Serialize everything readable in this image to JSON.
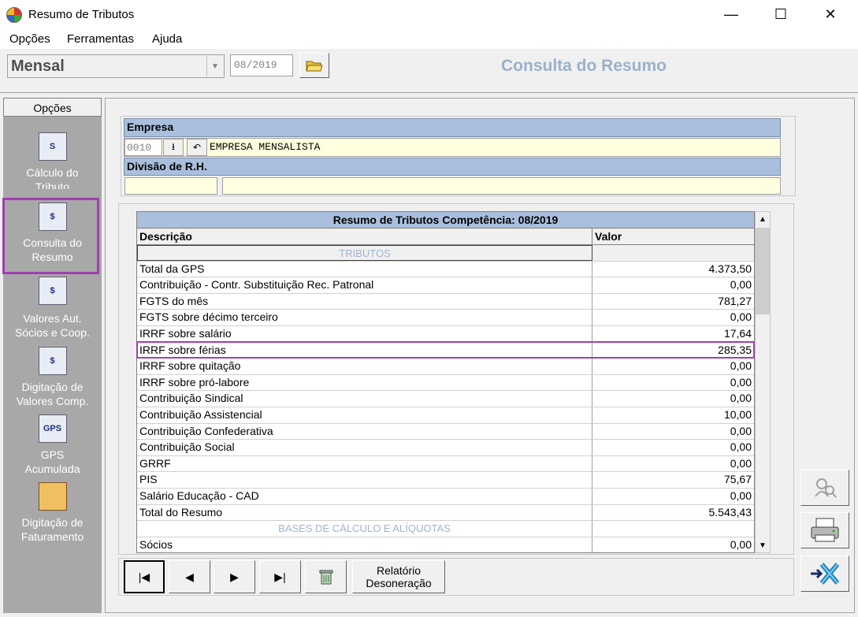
{
  "window": {
    "title": "Resumo de Tributos",
    "minimize": "—",
    "maximize": "☐",
    "close": "✕"
  },
  "menu": [
    "Opções",
    "Ferramentas",
    "Ajuda"
  ],
  "toolbar": {
    "period_type": "Mensal",
    "competencia": "08/2019",
    "heading": "Consulta do Resumo"
  },
  "sidebar": {
    "header": "Opções",
    "items": [
      {
        "label1": "Cálculo do",
        "label2": "Tributo",
        "icon": "S"
      },
      {
        "label1": "Consulta do",
        "label2": "Resumo",
        "icon": "$"
      },
      {
        "label1": "Valores Aut.",
        "label2": "Sócios e  Coop.",
        "icon": "$"
      },
      {
        "label1": "Digitação de",
        "label2": "Valores Comp.",
        "icon": "$"
      },
      {
        "label1": "GPS",
        "label2": "Acumulada",
        "icon": "GPS"
      },
      {
        "label1": "Digitação de",
        "label2": "Faturamento",
        "icon": ""
      }
    ]
  },
  "empresa": {
    "label": "Empresa",
    "code": "0010",
    "name": "EMPRESA MENSALISTA",
    "divisao_label": "Divisão de R.H."
  },
  "table": {
    "title": "Resumo de Tributos Competência: 08/2019",
    "col_desc": "Descrição",
    "col_valor": "Valor",
    "section1": "TRIBUTOS",
    "section2": "BASES DE CÁLCULO E ALÍQUOTAS",
    "rows": [
      {
        "desc": "Total da GPS",
        "valor": "4.373,50"
      },
      {
        "desc": "Contribuição - Contr. Substituição Rec. Patronal",
        "valor": "0,00"
      },
      {
        "desc": "FGTS do mês",
        "valor": "781,27"
      },
      {
        "desc": "FGTS sobre décimo terceiro",
        "valor": "0,00"
      },
      {
        "desc": "IRRF sobre salário",
        "valor": "17,64"
      },
      {
        "desc": "IRRF sobre férias",
        "valor": "285,35"
      },
      {
        "desc": "IRRF sobre quitação",
        "valor": "0,00"
      },
      {
        "desc": "IRRF sobre pró-labore",
        "valor": "0,00"
      },
      {
        "desc": "Contribuição Sindical",
        "valor": "0,00"
      },
      {
        "desc": "Contribuição Assistencial",
        "valor": "10,00"
      },
      {
        "desc": "Contribuição Confederativa",
        "valor": "0,00"
      },
      {
        "desc": "Contribuição Social",
        "valor": "0,00"
      },
      {
        "desc": "GRRF",
        "valor": "0,00"
      },
      {
        "desc": "PIS",
        "valor": "75,67"
      },
      {
        "desc": "Salário Educação - CAD",
        "valor": "0,00"
      },
      {
        "desc": "Total do Resumo",
        "valor": "5.543,43"
      }
    ],
    "after_rows": [
      {
        "desc": "Sócios",
        "valor": "0,00"
      }
    ]
  },
  "nav": {
    "first": "|◀",
    "prev": "◀",
    "next": "▶",
    "last": "▶|",
    "report_l1": "Relatório",
    "report_l2": "Desoneração"
  }
}
